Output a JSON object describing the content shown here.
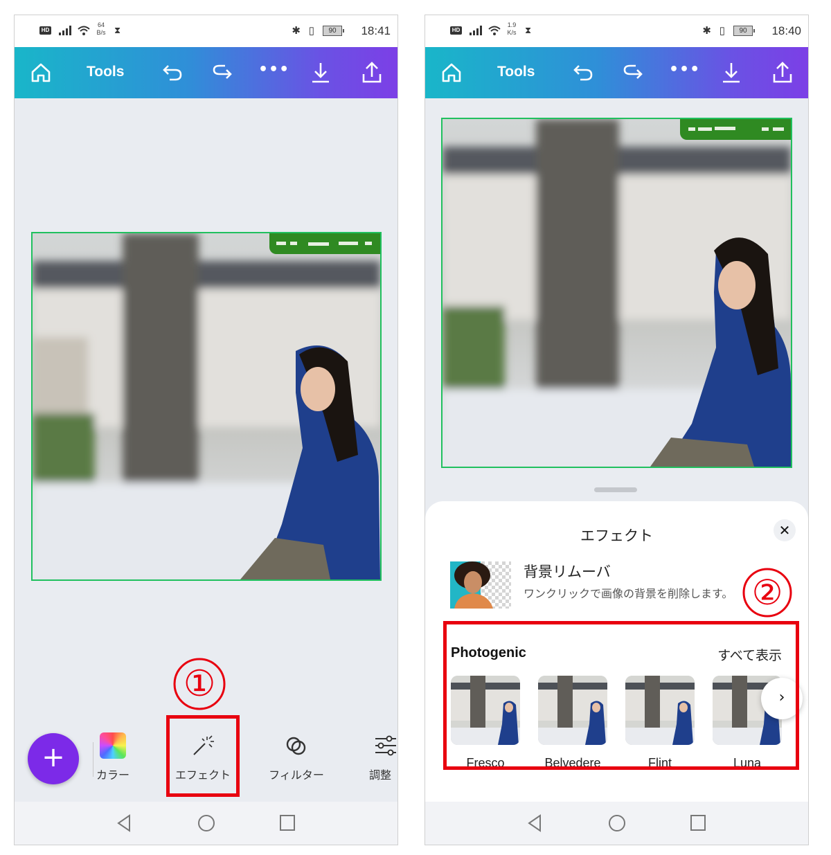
{
  "left_screen": {
    "status": {
      "network_speed": "64\nB/s",
      "battery": "90",
      "time": "18:41"
    },
    "toolbar": {
      "title": "Tools"
    },
    "bottom_tools": [
      {
        "label": "カラー",
        "icon": "color-palette-icon"
      },
      {
        "label": "エフェクト",
        "icon": "magic-wand-icon"
      },
      {
        "label": "フィルター",
        "icon": "filter-circles-icon"
      },
      {
        "label": "調整",
        "icon": "sliders-icon"
      }
    ],
    "fab_icon": "plus-icon",
    "annotation": "①"
  },
  "right_screen": {
    "status": {
      "network_speed": "1.9\nK/s",
      "battery": "90",
      "time": "18:40"
    },
    "toolbar": {
      "title": "Tools"
    },
    "sheet": {
      "title": "エフェクト",
      "bg_remover": {
        "title": "背景リムーバ",
        "description": "ワンクリックで画像の背景を削除します。"
      },
      "section_title": "Photogenic",
      "see_all": "すべて表示",
      "effects": [
        "Fresco",
        "Belvedere",
        "Flint",
        "Luna"
      ]
    },
    "annotation": "②"
  },
  "colors": {
    "highlight_red": "#e8000f",
    "fab_purple": "#7c2ae8",
    "gradient_start": "#19b6c9",
    "gradient_end": "#7c3fe6",
    "selection_green": "#20c05e"
  }
}
